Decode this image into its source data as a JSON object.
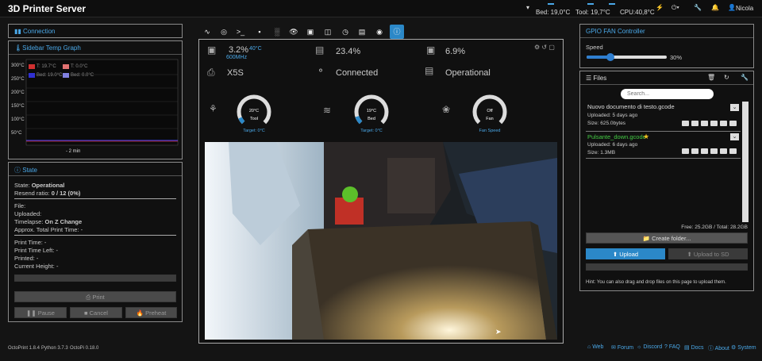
{
  "app": {
    "title": "3D Printer Server"
  },
  "topbar": {
    "bed": "Bed: 19,0°C",
    "tool": "Tool: 19,7°C",
    "cpu": "CPU:40,8°C",
    "user": "Nicola"
  },
  "connection": {
    "title": "Connection"
  },
  "tempgraph": {
    "title": "Sidebar Temp Graph",
    "ylabels": [
      "300°C",
      "250°C",
      "200°C",
      "150°C",
      "100°C",
      "50°C"
    ],
    "legend": [
      "T: 19.7°C",
      "T: 0.0°C",
      "Bed: 19.0°C",
      "Bed: 0.0°C"
    ],
    "xlabel": "- 2 min"
  },
  "state": {
    "title": "State",
    "state_label": "State:",
    "state_value": "Operational",
    "resend_label": "Resend ratio:",
    "resend_value": "0 / 12 (0%)",
    "file": "File:",
    "uploaded": "Uploaded:",
    "timelapse_label": "Timelapse:",
    "timelapse_value": "On Z Change",
    "approx": "Approx. Total Print Time: -",
    "print_time": "Print Time: -",
    "time_left": "Print Time Left: -",
    "printed": "Printed: -",
    "current_height": "Current Height: -",
    "print_btn": "Print",
    "pause_btn": "Pause",
    "cancel_btn": "Cancel",
    "preheat_btn": "Preheat"
  },
  "dashboard": {
    "cpu_pct": "3.2%",
    "cpu_temp": "40°C",
    "cpu_freq": "600MHz",
    "mem_pct": "23.4%",
    "disk_pct": "6.9%",
    "printer": "X5S",
    "connection": "Connected",
    "status": "Operational",
    "tool_gauge": {
      "value": "20°C",
      "name": "Tool",
      "target": "Target: 0°C",
      "fill": 0.08
    },
    "bed_gauge": {
      "value": "19°C",
      "name": "Bed",
      "target": "Target: 0°C",
      "fill": 0.1
    },
    "fan_gauge": {
      "value": "Off",
      "name": "Fan",
      "target": "Fan Speed",
      "fill": 0
    }
  },
  "gpio": {
    "title": "GPIO FAN Controller",
    "speed_label": "Speed",
    "speed_value": "30%",
    "speed_fraction": 0.3
  },
  "files": {
    "title": "Files",
    "search_placeholder": "Search...",
    "items": [
      {
        "name": "Nuovo documento di testo.gcode",
        "uploaded": "Uploaded: 5 days ago",
        "size": "Size: 625.0bytes"
      },
      {
        "name": "Pulsante_down.gcode",
        "uploaded": "Uploaded: 6 days ago",
        "size": "Size: 1.3MB"
      }
    ],
    "free": "Free: 25.2GB / Total: 28.2GB",
    "create_folder": "Create folder...",
    "upload": "Upload",
    "upload_sd": "Upload to SD",
    "hint": "Hint: You can also drag and drop files on this page to upload them."
  },
  "footer": {
    "octoprint": "OctoPrint 1.8.4",
    "python": "Python 3.7.3",
    "octopi": "OctoPi 0.18.0",
    "links": [
      "Web",
      "Forum",
      "Discord",
      "FAQ",
      "Docs",
      "About",
      "System"
    ]
  },
  "colors": {
    "accent": "#4aa8e8",
    "slider": "#2f7fd0",
    "upload_btn": "#2b88c8"
  }
}
